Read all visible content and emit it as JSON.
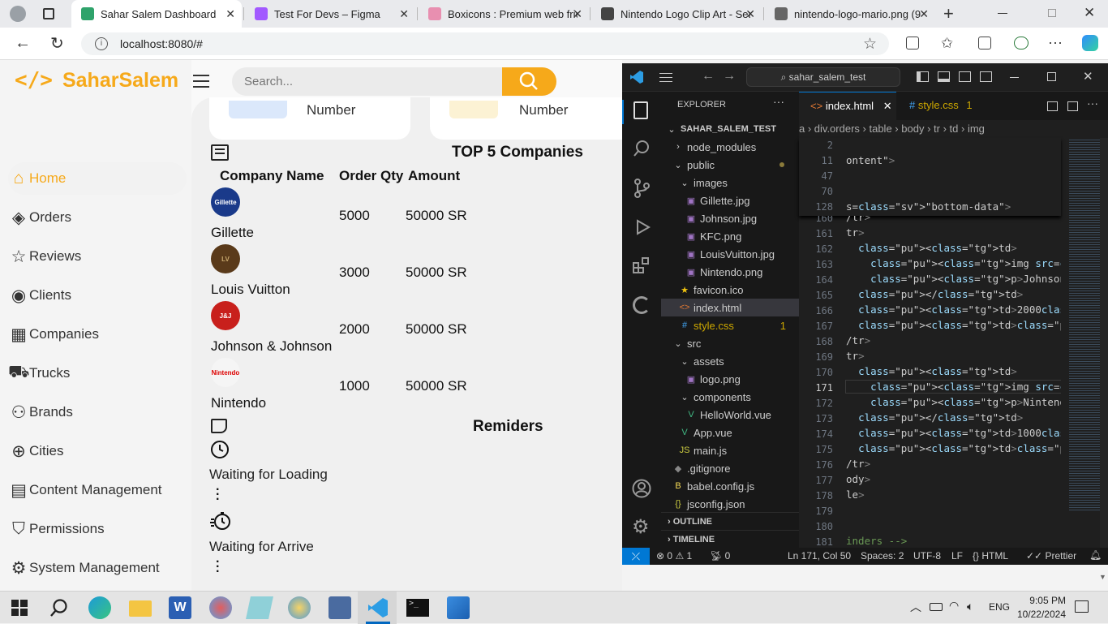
{
  "browser": {
    "tabs": [
      {
        "title": "Sahar Salem Dashboard",
        "active": true
      },
      {
        "title": "Test For Devs – Figma"
      },
      {
        "title": "Boxicons : Premium web frie"
      },
      {
        "title": "Nintendo Logo Clip Art - Sea"
      },
      {
        "title": "nintendo-logo-mario.png (9"
      }
    ],
    "url": "localhost:8080/#"
  },
  "dashboard": {
    "brand_first": "Sahar",
    "brand_second": "Salem",
    "search_placeholder": "Search...",
    "nav": [
      "Home",
      "Orders",
      "Reviews",
      "Clients",
      "Companies",
      "Trucks",
      "Brands",
      "Cities",
      "Content Management",
      "Permissions",
      "System Management"
    ],
    "stat_labels": [
      "Number",
      "Number"
    ],
    "companies_title": "TOP 5 Companies",
    "headers": [
      "Company Name",
      "Order Qty",
      "Amount"
    ],
    "rows": [
      {
        "name": "Gillette",
        "qty": "5000",
        "amount": "50000 SR",
        "logo_text": "Gillette"
      },
      {
        "name": "Louis Vuitton",
        "qty": "3000",
        "amount": "50000 SR",
        "logo_text": "LV"
      },
      {
        "name": "Johnson & Johnson",
        "qty": "2000",
        "amount": "50000 SR",
        "logo_text": "J&J"
      },
      {
        "name": "Nintendo",
        "qty": "1000",
        "amount": "50000 SR",
        "logo_text": "Nintendo"
      }
    ],
    "reminders_title": "Remiders",
    "reminders": [
      "Waiting for Loading",
      "Waiting for Arrive"
    ]
  },
  "vscode": {
    "search": "sahar_salem_test",
    "explorer_title": "EXPLORER",
    "tabs": [
      {
        "name": "index.html"
      },
      {
        "name": "style.css",
        "badge": "1"
      }
    ],
    "breadcrumb": [
      "a",
      "div.orders",
      "table",
      "body",
      "tr",
      "td",
      "img"
    ],
    "tree": [
      {
        "label": "SAHAR_SALEM_TEST",
        "indent": 0,
        "kind": "root"
      },
      {
        "label": "node_modules",
        "indent": 1,
        "kind": "folder-closed"
      },
      {
        "label": "public",
        "indent": 1,
        "kind": "folder-open"
      },
      {
        "label": "images",
        "indent": 2,
        "kind": "folder-open"
      },
      {
        "label": "Gillette.jpg",
        "indent": 3,
        "kind": "image"
      },
      {
        "label": "Johnson.jpg",
        "indent": 3,
        "kind": "image"
      },
      {
        "label": "KFC.png",
        "indent": 3,
        "kind": "image"
      },
      {
        "label": "LouisVuitton.jpg",
        "indent": 3,
        "kind": "image"
      },
      {
        "label": "Nintendo.png",
        "indent": 3,
        "kind": "image"
      },
      {
        "label": "favicon.ico",
        "indent": 2,
        "kind": "star"
      },
      {
        "label": "index.html",
        "indent": 2,
        "kind": "html"
      },
      {
        "label": "style.css",
        "indent": 2,
        "kind": "css",
        "badge": "1"
      },
      {
        "label": "src",
        "indent": 1,
        "kind": "folder-open"
      },
      {
        "label": "assets",
        "indent": 2,
        "kind": "folder-open"
      },
      {
        "label": "logo.png",
        "indent": 3,
        "kind": "image"
      },
      {
        "label": "components",
        "indent": 2,
        "kind": "folder-open"
      },
      {
        "label": "HelloWorld.vue",
        "indent": 3,
        "kind": "vue"
      },
      {
        "label": "App.vue",
        "indent": 2,
        "kind": "vue"
      },
      {
        "label": "main.js",
        "indent": 2,
        "kind": "js"
      },
      {
        "label": ".gitignore",
        "indent": 1,
        "kind": "git"
      },
      {
        "label": "babel.config.js",
        "indent": 1,
        "kind": "babel"
      },
      {
        "label": "jsconfig.json",
        "indent": 1,
        "kind": "json"
      }
    ],
    "outline": "OUTLINE",
    "timeline": "TIMELINE",
    "sticky": [
      {
        "ln": "2",
        "code": ""
      },
      {
        "ln": "11",
        "code": "ontent\">"
      },
      {
        "ln": "47",
        "code": ""
      },
      {
        "ln": "70",
        "code": ""
      },
      {
        "ln": "128",
        "code": "s=\"bottom-data\">"
      }
    ],
    "lines": [
      {
        "ln": "160",
        "code": "/tr>"
      },
      {
        "ln": "161",
        "code": "tr>"
      },
      {
        "ln": "162",
        "code": "  <td>"
      },
      {
        "ln": "163",
        "code": "    <img src=\"images/Johnson.jpg\">"
      },
      {
        "ln": "164",
        "code": "    <p>Johnson & Johnson</p>"
      },
      {
        "ln": "165",
        "code": "  </td>"
      },
      {
        "ln": "166",
        "code": "  <td>2000</td>"
      },
      {
        "ln": "167",
        "code": "  <td><span class=\"amount\">50000 SR"
      },
      {
        "ln": "168",
        "code": "/tr>"
      },
      {
        "ln": "169",
        "code": "tr>"
      },
      {
        "ln": "170",
        "code": "  <td>"
      },
      {
        "ln": "171",
        "code": "    <img src=\"images/Nintendo.png\">"
      },
      {
        "ln": "172",
        "code": "    <p>Nintendo</p>"
      },
      {
        "ln": "173",
        "code": "  </td>"
      },
      {
        "ln": "174",
        "code": "  <td>1000</td>"
      },
      {
        "ln": "175",
        "code": "  <td><span class=\"amount\">50000 SR"
      },
      {
        "ln": "176",
        "code": "/tr>"
      },
      {
        "ln": "177",
        "code": "ody>"
      },
      {
        "ln": "178",
        "code": "le>"
      },
      {
        "ln": "179",
        "code": ""
      },
      {
        "ln": "180",
        "code": ""
      },
      {
        "ln": "181",
        "code": "inders -->"
      }
    ],
    "status": {
      "errors": "0",
      "warnings": "1",
      "ports": "0",
      "cursor": "Ln 171, Col 50",
      "spaces": "Spaces: 2",
      "encoding": "UTF-8",
      "eol": "LF",
      "lang": "HTML",
      "formatter": "Prettier"
    }
  },
  "taskbar": {
    "lang": "ENG",
    "time": "9:05 PM",
    "date": "10/22/2024"
  },
  "colors": {
    "accent": "#f6a91a",
    "vscode_bg": "#1f1f1f",
    "vscode_blue": "#0078d4"
  }
}
